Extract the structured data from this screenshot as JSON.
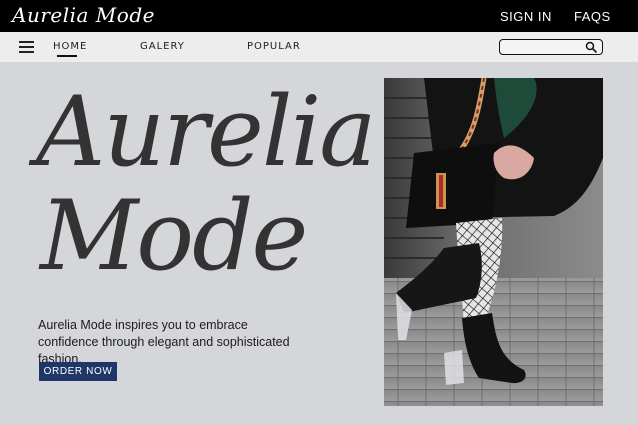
{
  "brand": {
    "logo_text": "Aurelia Mode"
  },
  "topbar": {
    "links": [
      "SIGN IN",
      "FAQS"
    ]
  },
  "nav": {
    "items": [
      {
        "label": "HOME",
        "active": true
      },
      {
        "label": "GALERY",
        "active": false
      },
      {
        "label": "POPULAR",
        "active": false
      }
    ],
    "search": {
      "value": "",
      "placeholder": ""
    }
  },
  "hero": {
    "title_line1": "Aurelia",
    "title_line2": "Mode",
    "tagline": "Aurelia Mode inspires you to embrace confidence through elegant and sophisticated fashion.",
    "cta_label": "ORDER NOW",
    "cta_color": "#1f3766"
  },
  "icons": {
    "menu": "hamburger-menu-icon",
    "search": "search-icon"
  },
  "colors": {
    "topbar": "#000000",
    "navbar": "#ededee",
    "page": "#d5d6da"
  }
}
